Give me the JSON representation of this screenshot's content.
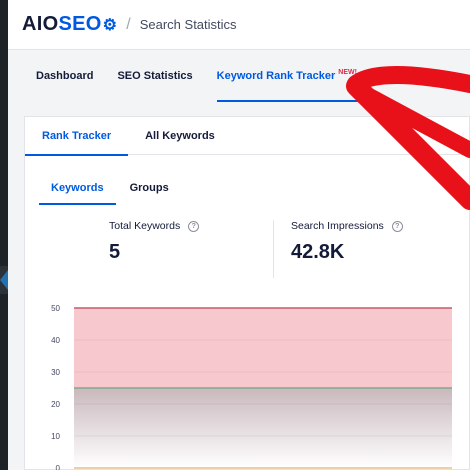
{
  "header": {
    "logo": {
      "text_left": "AIO",
      "text_right": "SEO"
    },
    "breadcrumb_separator": "/",
    "breadcrumb": "Search Statistics"
  },
  "main_tabs": [
    {
      "label": "Dashboard"
    },
    {
      "label": "SEO Statistics"
    },
    {
      "label": "Keyword Rank Tracker",
      "badge": "NEW!"
    }
  ],
  "sub_tabs": [
    {
      "label": "Rank Tracker"
    },
    {
      "label": "All Keywords"
    }
  ],
  "inner_tabs": [
    {
      "label": "Keywords"
    },
    {
      "label": "Groups"
    }
  ],
  "stats": [
    {
      "label": "Total Keywords",
      "value": "5",
      "help": "?"
    },
    {
      "label": "Search Impressions",
      "value": "42.8K",
      "help": "?"
    }
  ],
  "chart_data": {
    "type": "area",
    "y_ticks": [
      "50",
      "40",
      "30",
      "20",
      "10",
      "0"
    ],
    "ylim": [
      0,
      50
    ],
    "bands": [
      {
        "from": 25,
        "to": 50,
        "color": "#f7c9cf",
        "line_color": "#d0606e"
      },
      {
        "from": 0,
        "to": 25,
        "color": "#c9b8bd",
        "line_color": "#7daa8c"
      }
    ],
    "baseline_color": "#e6c08a"
  },
  "colors": {
    "accent": "#005ae0",
    "annotation_arrow": "#e8111a"
  }
}
